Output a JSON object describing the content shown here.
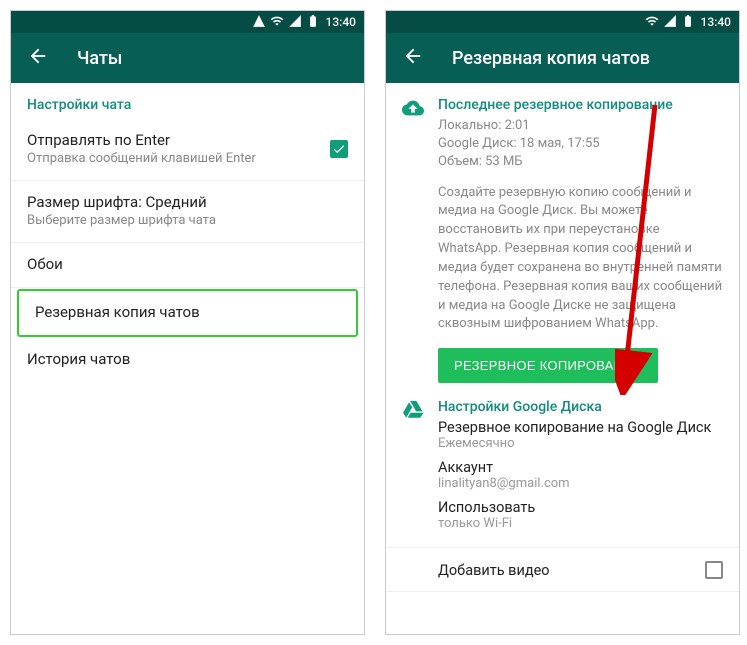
{
  "statusbar": {
    "time": "13:40"
  },
  "left": {
    "title": "Чаты",
    "section_header": "Настройки чата",
    "enter_send": {
      "title": "Отправлять по Enter",
      "sub": "Отправка сообщений клавишей Enter"
    },
    "font_size": {
      "title": "Размер шрифта: Средний",
      "sub": "Выберите размер шрифта чата"
    },
    "wallpaper": "Обои",
    "backup": "Резервная копия чатов",
    "history": "История чатов"
  },
  "right": {
    "title": "Резервная копия чатов",
    "last_backup": {
      "header": "Последнее резервное копирование",
      "local": "Локально: 2:01",
      "gdrive": "Google Диск: 18 мая, 17:55",
      "size": "Объем: 53 МБ"
    },
    "description": "Создайте резервную копию сообщений и медиа на Google Диск. Вы можете восстановить их при переустановке WhatsApp. Резервная копия сообщений и медиа будет сохранена во внутренней памяти телефона. Резервная копия ваших сообщений и медиа на Google Диске не защищена сквозным шифрованием WhatsApp.",
    "backup_button": "РЕЗЕРВНОЕ КОПИРОВАНИЕ",
    "gdrive": {
      "header": "Настройки Google Диска",
      "backup_to": {
        "title": "Резервное копирование на Google Диск",
        "sub": "Ежемесячно"
      },
      "account": {
        "title": "Аккаунт",
        "sub": "linalityan8@gmail.com"
      },
      "use": {
        "title": "Использовать",
        "sub": "только Wi-Fi"
      },
      "add_video": "Добавить видео"
    }
  }
}
